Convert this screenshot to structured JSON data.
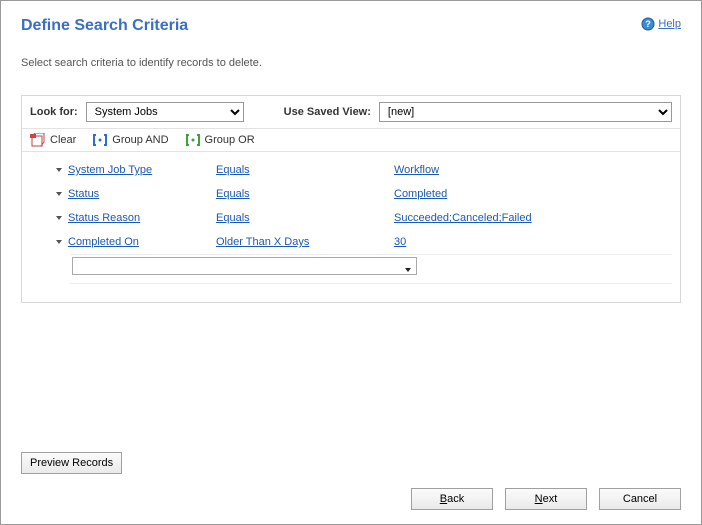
{
  "title": "Define Search Criteria",
  "help_label": "Help",
  "subtitle": "Select search criteria to identify records to delete.",
  "look_for_label": "Look for:",
  "look_for_value": "System Jobs",
  "saved_view_label": "Use Saved View:",
  "saved_view_value": "[new]",
  "toolbar": {
    "clear": "Clear",
    "group_and": "Group AND",
    "group_or": "Group OR"
  },
  "criteria": [
    {
      "field": "System Job Type",
      "op": "Equals",
      "val": "Workflow"
    },
    {
      "field": "Status",
      "op": "Equals",
      "val": "Completed"
    },
    {
      "field": "Status Reason",
      "op": "Equals",
      "val": "Succeeded;Canceled;Failed"
    },
    {
      "field": "Completed On",
      "op": "Older Than X Days",
      "val": "30"
    }
  ],
  "preview_label": "Preview Records",
  "buttons": {
    "back": "Back",
    "back_ul": "B",
    "back_rest": "ack",
    "next": "Next",
    "next_ul": "N",
    "next_rest": "ext",
    "cancel": "Cancel"
  }
}
